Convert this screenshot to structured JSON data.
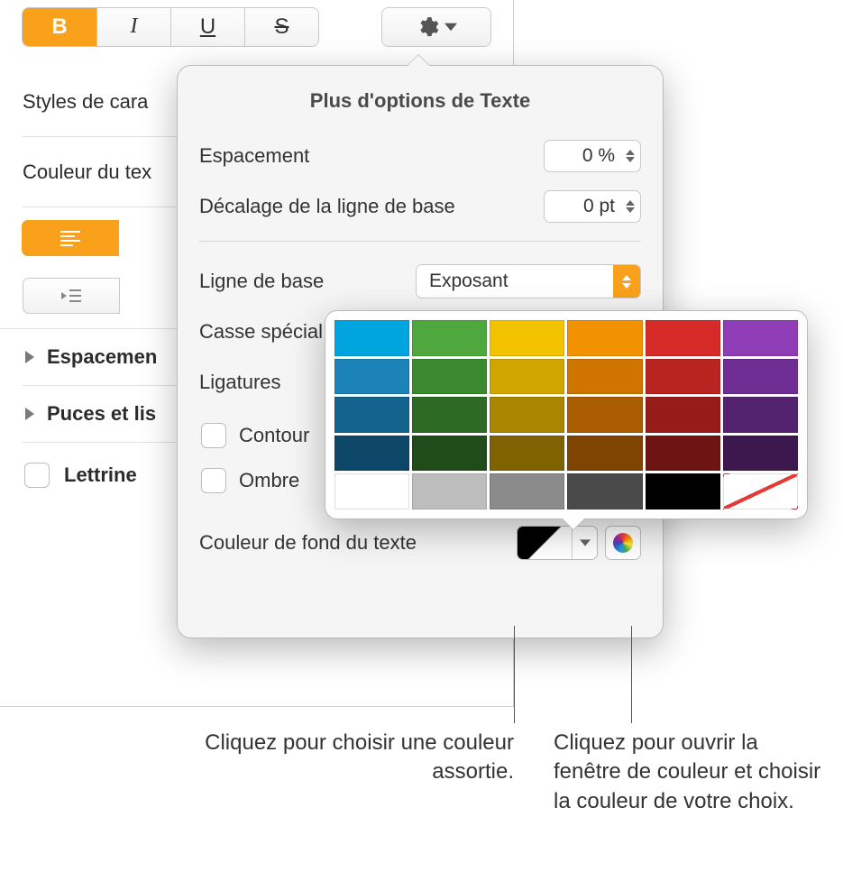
{
  "toolbar": {
    "bold": "B",
    "italic": "I",
    "underline": "U",
    "strike": "S"
  },
  "sidebar": {
    "char_styles": "Styles de cara",
    "text_color": "Couleur du tex",
    "spacing": "Espacemen",
    "bullets": "Puces et lis",
    "dropcap": "Lettrine"
  },
  "popover": {
    "title": "Plus d'options de Texte",
    "spacing_label": "Espacement",
    "spacing_value": "0 %",
    "baseline_shift_label": "Décalage de la ligne de base",
    "baseline_shift_value": "0 pt",
    "baseline_label": "Ligne de base",
    "baseline_value": "Exposant",
    "caps_label": "Casse spécial",
    "ligatures_label": "Ligatures",
    "outline_label": "Contour",
    "shadow_label": "Ombre",
    "bg_color_label": "Couleur de fond du texte"
  },
  "palette": {
    "rows": [
      [
        "#00a5e0",
        "#4fa83d",
        "#f4c300",
        "#f39200",
        "#d62a28",
        "#8e3db6"
      ],
      [
        "#1c83b8",
        "#3c8a30",
        "#d0a500",
        "#d07400",
        "#b92320",
        "#6f2e94"
      ],
      [
        "#13638e",
        "#2d6a24",
        "#a98500",
        "#a95c00",
        "#951c18",
        "#54236f"
      ],
      [
        "#0d4767",
        "#1f4c19",
        "#7f6300",
        "#7f4400",
        "#6e1412",
        "#3c184f"
      ]
    ],
    "grays": [
      "#ffffff",
      "#bdbdbd",
      "#8b8b8b",
      "#4a4a4a",
      "#000000"
    ]
  },
  "callouts": {
    "left": "Cliquez pour choisir une couleur assortie.",
    "right": "Cliquez pour ouvrir la fenêtre de couleur et choisir la couleur de votre choix."
  }
}
